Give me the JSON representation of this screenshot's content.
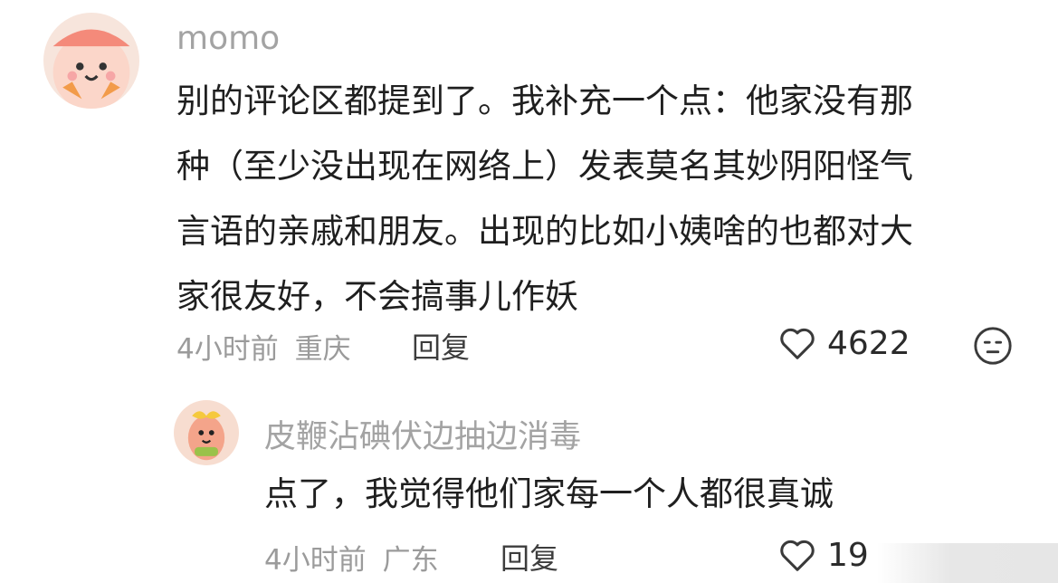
{
  "comments": [
    {
      "username": "momo",
      "text": "别的评论区都提到了。我补充一个点：他家没有那种（至少没出现在网络上）发表莫名其妙阴阳怪气言语的亲戚和朋友。出现的比如小姨啥的也都对大家很友好，不会搞事儿作妖",
      "lines": [
        "别的评论区都提到了。我补充一个点：他家没有那",
        "种（至少没出现在网络上）发表莫名其妙阴阳怪气",
        "言语的亲戚和朋友。出现的比如小姨啥的也都对大",
        "家很友好，不会搞事儿作妖"
      ],
      "time": "4小时前",
      "location": "重庆",
      "reply_label": "回复",
      "likes": "4622"
    },
    {
      "username": "皮鞭沾碘伏边抽边消毒",
      "text": "点了，我觉得他们家每一个人都很真诚",
      "time": "4小时前",
      "location": "广东",
      "reply_label": "回复",
      "likes": "19"
    }
  ],
  "colors": {
    "avatar1_bg": "#f7e3d8",
    "avatar2_bg": "#f3cdb8",
    "accent": "#e88a6a"
  },
  "icons": [
    "heart-icon",
    "unhappy-face-icon"
  ]
}
